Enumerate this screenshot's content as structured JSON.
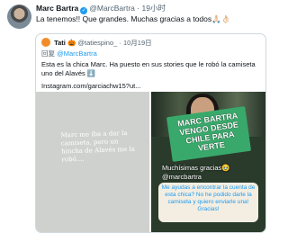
{
  "tweet": {
    "author_name": "Marc Bartra",
    "author_handle": "@MarcBartra",
    "time": "· 19小时",
    "text": "La tenemos!! Que grandes. Muchas gracias a todos🙏🏻👌🏻"
  },
  "quote": {
    "author_name": "Tati 🎃",
    "author_handle": "@tatiespino_",
    "time": "· 10月19日",
    "reply_prefix": "回复",
    "reply_to": "@MarcBartra",
    "body": "Esta es la chica Marc. Ha puesto en sus stories que le robó la camiseta uno del Alavés ⬇️",
    "url": "Instagram.com/garciachw15?ut...",
    "media_left_text": "Marc me iba a dar la camiseta, pero un hincha de Alavés me la robó....",
    "media_right": {
      "sign_text": "MARC BARTRA VENGO DESDE CHILE PARA VERTE",
      "caption1": "Muchísimas gracias🥹",
      "caption2": "@marcbartra",
      "bubble_text": "Me ayudas a encontrar la cuenta de esta chica? No he podido darle la camiseta y quiero enviarle una! Gracias!"
    }
  },
  "colors": {
    "accent": "#1d9bf0",
    "muted": "#536471",
    "border": "#cfd9de",
    "sign": "#39a96b"
  }
}
